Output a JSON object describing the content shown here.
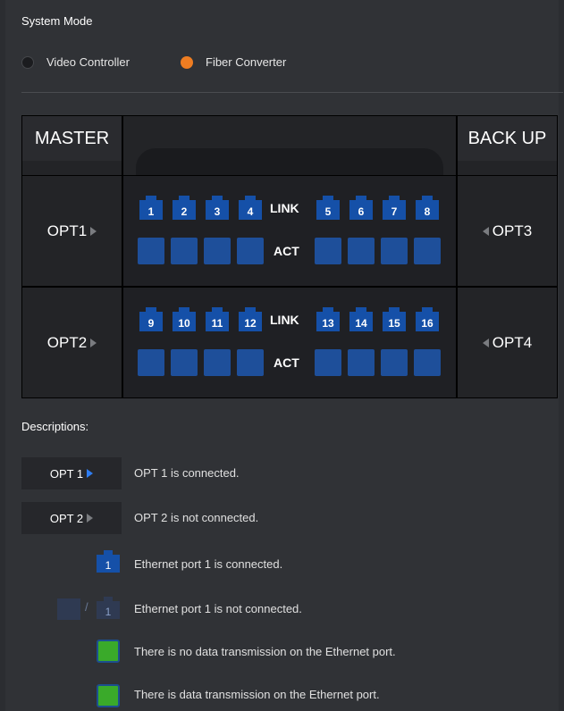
{
  "system_mode": {
    "title": "System Mode",
    "options": [
      {
        "label": "Video Controller",
        "selected": false
      },
      {
        "label": "Fiber Converter",
        "selected": true
      }
    ],
    "accent_color": "#ee7d22"
  },
  "panel": {
    "master_label": "MASTER",
    "backup_label": "BACK UP",
    "rows": [
      {
        "left": "OPT1",
        "right": "OPT3",
        "ports_left": [
          "1",
          "2",
          "3",
          "4"
        ],
        "ports_right": [
          "5",
          "6",
          "7",
          "8"
        ],
        "link": "LINK",
        "act": "ACT"
      },
      {
        "left": "OPT2",
        "right": "OPT4",
        "ports_left": [
          "9",
          "10",
          "11",
          "12"
        ],
        "ports_right": [
          "13",
          "14",
          "15",
          "16"
        ],
        "link": "LINK",
        "act": "ACT"
      }
    ],
    "port_color": "#1550a8"
  },
  "descriptions": {
    "title": "Descriptions:",
    "items": [
      {
        "sample": "OPT 1",
        "icon": "arrow-right-blue-icon",
        "text": "OPT 1 is connected."
      },
      {
        "sample": "OPT 2",
        "icon": "arrow-right-gray-icon",
        "text": "OPT 2 is not connected."
      },
      {
        "sample": "1",
        "icon": "ethernet-connected-icon",
        "text": "Ethernet port 1 is connected."
      },
      {
        "sample": "1",
        "icon": "ethernet-disconnected-icon",
        "text": "Ethernet port 1 is not connected."
      },
      {
        "icon": "act-green-icon",
        "text": "There is no data transmission on the Ethernet port."
      },
      {
        "icon": "act-green-icon",
        "text": "There is data transmission on the Ethernet port."
      }
    ]
  }
}
